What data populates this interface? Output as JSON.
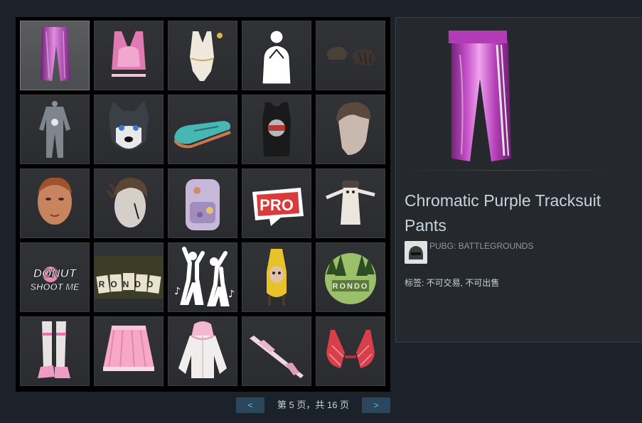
{
  "inventory": {
    "items": [
      {
        "name": "pink-tracksuit-pants-icon",
        "selected": true
      },
      {
        "name": "pink-sports-bra-icon"
      },
      {
        "name": "white-swimsuit-icon"
      },
      {
        "name": "emote-pose-icon"
      },
      {
        "name": "dark-gloves-icon"
      },
      {
        "name": "grey-jumpsuit-icon"
      },
      {
        "name": "husky-mask-icon"
      },
      {
        "name": "teal-slip-on-shoes-icon"
      },
      {
        "name": "black-tank-top-icon"
      },
      {
        "name": "hairstyle-head-icon"
      },
      {
        "name": "female-face-icon"
      },
      {
        "name": "braided-hair-icon"
      },
      {
        "name": "floral-backpack-icon"
      },
      {
        "name": "pro-sticker-icon"
      },
      {
        "name": "cat-spray-icon"
      },
      {
        "name": "donut-shoot-me-spray-icon"
      },
      {
        "name": "rondo-cards-spray-icon"
      },
      {
        "name": "dance-emote-icon"
      },
      {
        "name": "banana-figure-spray-icon"
      },
      {
        "name": "rondo-forest-spray-icon"
      },
      {
        "name": "pink-boots-icon"
      },
      {
        "name": "pink-pleated-skirt-icon"
      },
      {
        "name": "pink-hooded-jacket-icon"
      },
      {
        "name": "pink-rifle-skin-icon"
      },
      {
        "name": "red-plaid-bra-icon"
      }
    ],
    "texts": {
      "donut_line1": "DONUT",
      "donut_line2": "SHOOT ME",
      "pro": "PRO",
      "rondo": "RONDO"
    }
  },
  "pagination": {
    "prev_label": "<",
    "next_label": ">",
    "page_text": "第 5 页，共 16 页"
  },
  "detail": {
    "item_name": "Chromatic Purple Tracksuit Pants",
    "game_name": "PUBG: BATTLEGROUNDS",
    "tags": "标签: 不可交易, 不可出售"
  },
  "colors": {
    "background": "#1b2229",
    "accent": "#66c0f4",
    "button_bg": "#2a475e",
    "purple_item": "#c24fc6"
  }
}
